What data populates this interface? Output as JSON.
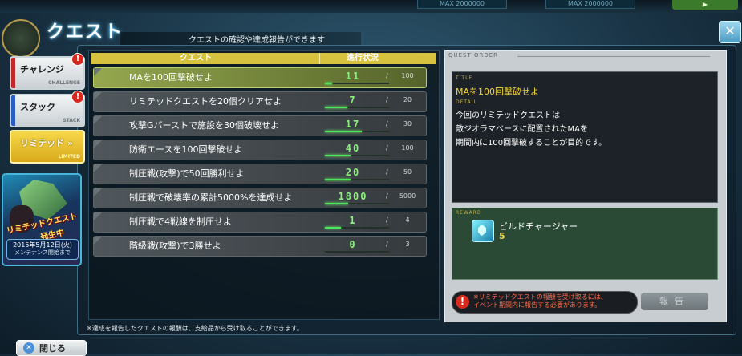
{
  "header": {
    "title": "クエスト",
    "subtitle": "クエストの確認や達成報告ができます",
    "top_values": [
      "MAX 2000000",
      "MAX 2000000"
    ]
  },
  "sidebar": {
    "tabs": [
      {
        "label": "チャレンジ",
        "sub": "CHALLENGE",
        "badge": "!"
      },
      {
        "label": "スタック",
        "sub": "STACK",
        "badge": "!"
      },
      {
        "label": "リミテッド",
        "sub": "LIMITED",
        "badge": ""
      }
    ],
    "promo": {
      "headline": "リミテッドクエスト",
      "headline2": "発生中",
      "date": "2015年5月12日(火)",
      "date_sub": "メンテナンス開始まで"
    }
  },
  "list": {
    "col_quest": "クエスト",
    "col_progress": "進行状況",
    "rows": [
      {
        "name": "MAを100回撃破せよ",
        "current": "11",
        "max": "100",
        "ratio": 0.11
      },
      {
        "name": "リミテッドクエストを20個クリアせよ",
        "current": "7",
        "max": "20",
        "ratio": 0.35
      },
      {
        "name": "攻撃Gバーストで施設を30個破壊せよ",
        "current": "17",
        "max": "30",
        "ratio": 0.57
      },
      {
        "name": "防衛エースを100回撃破せよ",
        "current": "40",
        "max": "100",
        "ratio": 0.4
      },
      {
        "name": "制圧戦(攻撃)で50回勝利せよ",
        "current": "20",
        "max": "50",
        "ratio": 0.4
      },
      {
        "name": "制圧戦で破壊率の累計5000%を達成せよ",
        "current": "1800",
        "max": "5000",
        "ratio": 0.36
      },
      {
        "name": "制圧戦で4戦線を制圧せよ",
        "current": "1",
        "max": "4",
        "ratio": 0.25
      },
      {
        "name": "階級戦(攻撃)で3勝せよ",
        "current": "0",
        "max": "3",
        "ratio": 0
      }
    ],
    "note": "※達成を報告したクエストの報酬は、支給品から受け取ることができます。"
  },
  "detail": {
    "header": "QUEST ORDER",
    "title_label": "TITLE",
    "title": "MAを100回撃破せよ",
    "detail_label": "DETAIL",
    "description": "今回のリミテッドクエストは\n敵ジオラマベースに配置されたMAを\n期間内に100回撃破することが目的です。",
    "reward_label": "REWARD",
    "reward_name": "ビルドチャージャー",
    "reward_count": "5",
    "warning": "※リミテッドクエストの報酬を受け取るには、\nイベント期間内に報告する必要があります。",
    "report_label": "報告"
  },
  "footer": {
    "close_label": "閉じる"
  }
}
